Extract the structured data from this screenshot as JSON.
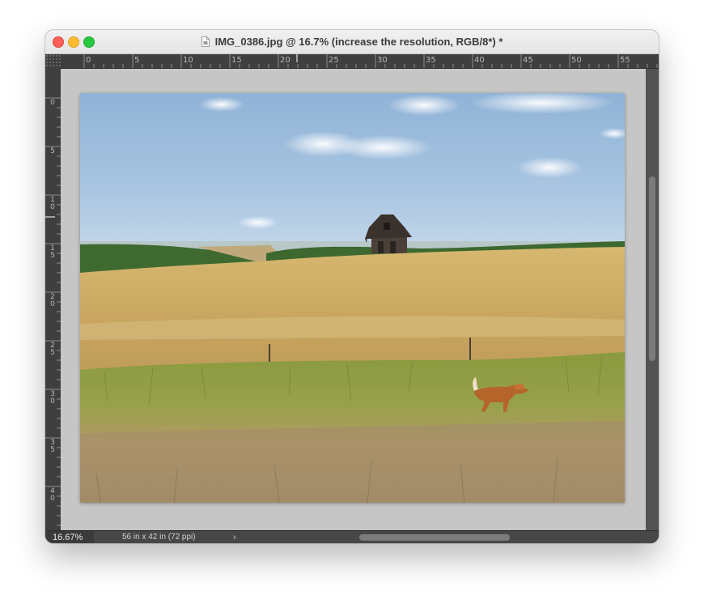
{
  "window": {
    "title": "IMG_0386.jpg @ 16.7% (increase the resolution, RGB/8*) *",
    "doc_icon": "document-icon"
  },
  "ruler": {
    "top_labels": [
      "0",
      "5",
      "10",
      "15",
      "20",
      "25",
      "30",
      "35",
      "40",
      "45",
      "50",
      "55"
    ],
    "left_labels": [
      "0",
      "5",
      "1\n0",
      "1\n5",
      "2\n0",
      "2\n5",
      "3\n0",
      "3\n5",
      "4\n0"
    ]
  },
  "image": {
    "description_icon": "photo-canvas"
  },
  "status": {
    "zoom": "16.67%",
    "doc_info": "56 in x 42 in (72 ppi)",
    "arrow": "›"
  },
  "colors": {
    "close": "#fe5f57",
    "minimize": "#febc2e",
    "maximize": "#28c840",
    "pasteboard": "#c6c6c6",
    "ruler": "#3f3f3f"
  }
}
